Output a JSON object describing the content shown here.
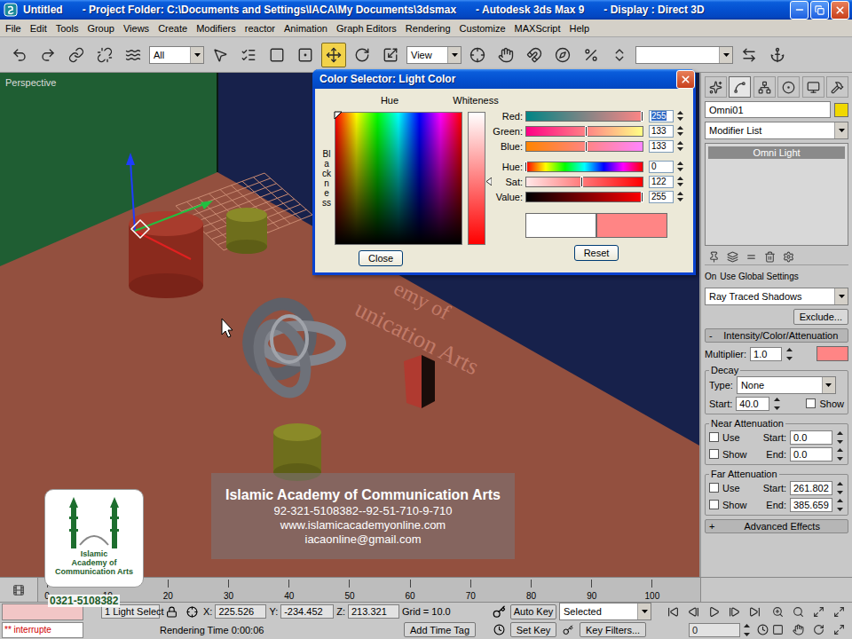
{
  "window": {
    "title_parts": [
      "Untitled",
      "- Project Folder: C:\\Documents and Settings\\IACA\\My Documents\\3dsmax",
      "- Autodesk 3ds Max 9",
      "- Display : Direct 3D"
    ]
  },
  "menu": [
    "File",
    "Edit",
    "Tools",
    "Group",
    "Views",
    "Create",
    "Modifiers",
    "reactor",
    "Animation",
    "Graph Editors",
    "Rendering",
    "Customize",
    "MAXScript",
    "Help"
  ],
  "toolbar": {
    "items": [
      {
        "kind": "undo",
        "selected": false
      },
      {
        "kind": "redo",
        "selected": false
      },
      {
        "kind": "link",
        "selected": false
      },
      {
        "kind": "unlink",
        "selected": false
      },
      {
        "kind": "bind",
        "selected": false
      },
      {
        "kind": "dropdown",
        "text": "All"
      },
      {
        "kind": "select",
        "selected": false
      },
      {
        "kind": "select-by-name",
        "selected": false
      },
      {
        "kind": "region",
        "selected": false
      },
      {
        "kind": "crossing",
        "selected": false
      },
      {
        "kind": "move",
        "selected": true
      },
      {
        "kind": "rotate",
        "selected": false
      },
      {
        "kind": "scale",
        "selected": false
      },
      {
        "kind": "dropdown",
        "text": "View"
      },
      {
        "kind": "pivot",
        "selected": false
      },
      {
        "kind": "manipulate",
        "selected": false
      },
      {
        "kind": "snap",
        "selected": false
      },
      {
        "kind": "angle-snap",
        "selected": false
      },
      {
        "kind": "percent-snap",
        "selected": false
      },
      {
        "kind": "spinner-snap",
        "selected": false
      },
      {
        "kind": "field"
      },
      {
        "kind": "mirror",
        "selected": false
      },
      {
        "kind": "align",
        "selected": false
      }
    ]
  },
  "viewport": {
    "label": "Perspective",
    "scene_text": [
      "emy of",
      "unication Arts"
    ]
  },
  "dialog": {
    "title": "Color Selector: Light Color",
    "hue_label": "Hue",
    "whiteness_label": "Whiteness",
    "blackness_label": "Blackness",
    "whiteness_level": 0.52,
    "channels": [
      {
        "label": "Red:",
        "value": "255",
        "level": 1,
        "selected": true,
        "colors": [
          "#008585",
          "#ff8585"
        ]
      },
      {
        "label": "Green:",
        "value": "133",
        "level": 0.52,
        "selected": false,
        "colors": [
          "#ff0085",
          "#ffff85"
        ]
      },
      {
        "label": "Blue:",
        "value": "133",
        "level": 0.52,
        "selected": false,
        "colors": [
          "#ff8500",
          "#ff85ff"
        ]
      }
    ],
    "hsv": [
      {
        "label": "Hue:",
        "value": "0",
        "level": 0,
        "selected": false,
        "colors": [
          "#ff0000",
          "#ffff00",
          "#00ff00",
          "#00ffff",
          "#0000ff",
          "#ff00ff",
          "#ff0000"
        ]
      },
      {
        "label": "Sat:",
        "value": "122",
        "level": 0.48,
        "selected": false,
        "colors": [
          "#ffe8e8",
          "#ff0000"
        ]
      },
      {
        "label": "Value:",
        "value": "255",
        "level": 1,
        "selected": false,
        "colors": [
          "#000000",
          "#ff0000"
        ]
      }
    ],
    "old_color": "#ffffff",
    "new_color": "#ff8585",
    "close_button": "Close",
    "reset_button": "Reset"
  },
  "command_panel": {
    "tabs": [
      {
        "kind": "create",
        "selected": false
      },
      {
        "kind": "modify",
        "selected": true
      },
      {
        "kind": "hierarchy",
        "selected": false
      },
      {
        "kind": "motion",
        "selected": false
      },
      {
        "kind": "display",
        "selected": false
      },
      {
        "kind": "utilities",
        "selected": false
      }
    ],
    "object_name": "Omni01",
    "object_color": "#f0d800",
    "modifier_list": "Modifier List",
    "stack": [
      {
        "label": "Omni Light",
        "selected": true
      }
    ],
    "shadows": {
      "on_label": "On",
      "global_label": "Use Global Settings",
      "type": "Ray Traced Shadows",
      "exclude": "Exclude..."
    },
    "intensity": {
      "glyph": "-",
      "title": "Intensity/Color/Attenuation",
      "multiplier_label": "Multiplier:",
      "multiplier": "1.0",
      "color": "#ff8585",
      "decay": {
        "title": "Decay",
        "type_label": "Type:",
        "type": "None",
        "start_label": "Start:",
        "start": "40.0",
        "show_label": "Show",
        "show": false
      },
      "near": {
        "title": "Near Attenuation",
        "use_label": "Use",
        "use": false,
        "start_label": "Start:",
        "start": "0.0",
        "show_label": "Show",
        "show": false,
        "end_label": "End:",
        "end": "0.0"
      },
      "far": {
        "title": "Far Attenuation",
        "use_label": "Use",
        "use": false,
        "start_label": "Start:",
        "start": "261.802",
        "show_label": "Show",
        "show": false,
        "end_label": "End:",
        "end": "385.659"
      }
    },
    "rollouts": [
      {
        "glyph": "+",
        "title": "Advanced Effects"
      }
    ]
  },
  "timeline": {
    "ticks": [
      "0",
      "10",
      "20",
      "30",
      "40",
      "50",
      "60",
      "70",
      "80",
      "90",
      "100"
    ]
  },
  "status_bar": {
    "listener": "** interrupte",
    "selection": "1 Light Select",
    "x_label": "X:",
    "x": "225.526",
    "y_label": "Y:",
    "y": "-234.452",
    "z_label": "Z:",
    "z": "213.321",
    "grid": "Grid = 10.0",
    "prompt": "Rendering Time 0:00:06",
    "time_tag": "Add Time Tag",
    "auto_key": "Auto Key",
    "auto_key_on": false,
    "key_mode": "Selected",
    "set_key": "Set Key",
    "key_filters": "Key Filters...",
    "frame": "0"
  },
  "watermark": {
    "title": "Islamic Academy of Communication Arts",
    "lines": [
      "92-321-5108382--92-51-710-9-710",
      "www.islamicacademyonline.com",
      "iacaonline@gmail.com"
    ]
  },
  "logo": {
    "lines": [
      "Islamic",
      "Academy of",
      "Communication Arts"
    ],
    "phone": "0321-5108382"
  }
}
